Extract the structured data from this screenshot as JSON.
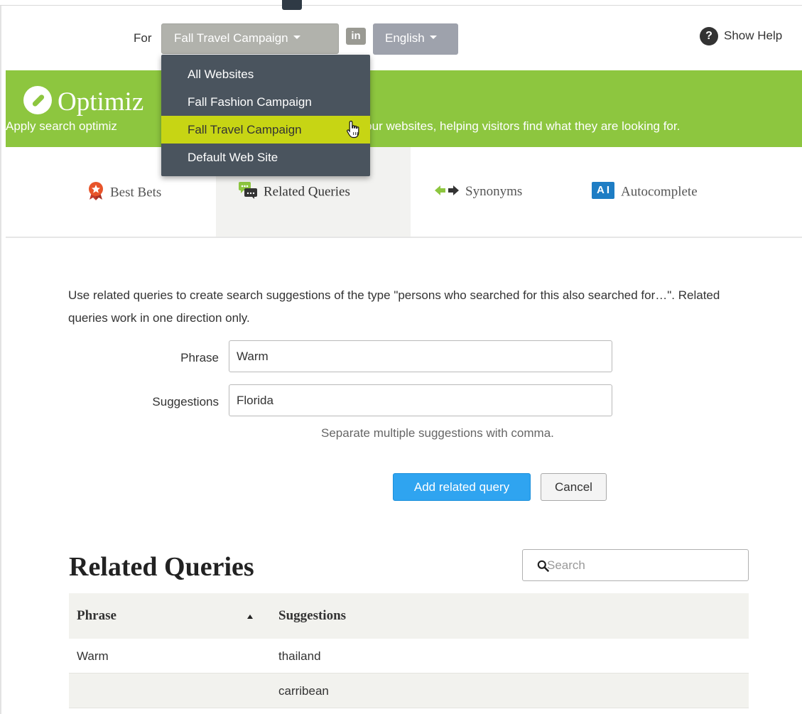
{
  "topbar": {
    "for_label": "For",
    "site_selected": "Fall Travel Campaign",
    "in_label": "in",
    "language_selected": "English",
    "help_label": "Show Help"
  },
  "site_menu": {
    "items": [
      "All Websites",
      "Fall Fashion Campaign",
      "Fall Travel Campaign",
      "Default Web Site"
    ],
    "highlighted": "Fall Travel Campaign"
  },
  "banner": {
    "title": "Optimiz",
    "description_left": "Apply search optimiz",
    "description_right": "n on your websites, helping visitors find what they are looking for.",
    "color": "#8dc63f"
  },
  "tabs": [
    {
      "label": "Best Bets",
      "icon": "best-bets-badge-icon",
      "active": false
    },
    {
      "label": "Related Queries",
      "icon": "chat-bubbles-icon",
      "active": true
    },
    {
      "label": "Synonyms",
      "icon": "double-arrow-icon",
      "active": false
    },
    {
      "label": "Autocomplete",
      "icon": "ai-text-icon",
      "active": false
    }
  ],
  "form": {
    "intro": "Use related queries to create search suggestions of the type \"persons who searched for this also searched for…\". Related queries work in one direction only.",
    "phrase_label": "Phrase",
    "phrase_value": "Warm",
    "suggestions_label": "Suggestions",
    "suggestions_value": "Florida",
    "hint": "Separate multiple suggestions with comma.",
    "add_button": "Add related query",
    "cancel_button": "Cancel"
  },
  "list": {
    "title": "Related Queries",
    "search_placeholder": "Search",
    "columns": [
      "Phrase",
      "Suggestions"
    ],
    "rows": [
      {
        "phrase": "Warm",
        "suggestion": "thailand"
      },
      {
        "phrase": "",
        "suggestion": "carribean"
      }
    ]
  },
  "colors": {
    "accent_blue": "#2fa4f0",
    "menu_highlight": "#c7d514",
    "menu_background": "#4a545e"
  }
}
